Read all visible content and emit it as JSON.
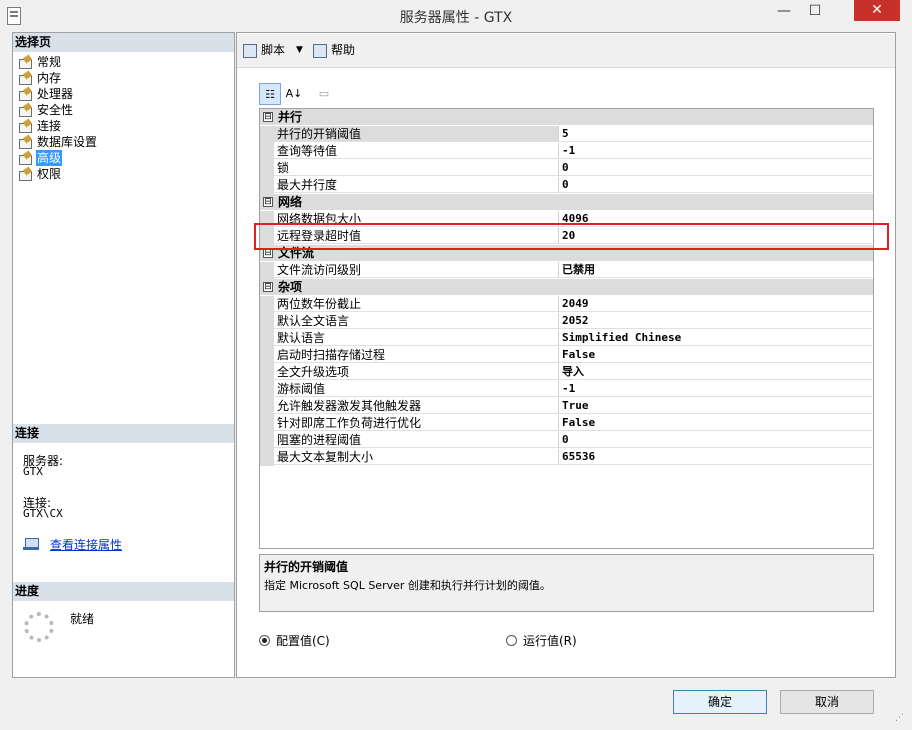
{
  "window": {
    "title": "服务器属性 - GTX",
    "minimize_label": "—",
    "maximize_label": "☐",
    "close_label": "✕"
  },
  "left": {
    "select_page_header": "选择页",
    "pages": [
      {
        "label": "常规"
      },
      {
        "label": "内存"
      },
      {
        "label": "处理器"
      },
      {
        "label": "安全性"
      },
      {
        "label": "连接"
      },
      {
        "label": "数据库设置"
      },
      {
        "label": "高级",
        "selected": true
      },
      {
        "label": "权限"
      }
    ],
    "connection_header": "连接",
    "server_label": "服务器:",
    "server_value": "GTX",
    "connection_label": "连接:",
    "connection_value": "GTX\\CX",
    "view_props_link": "查看连接属性",
    "progress_header": "进度",
    "progress_status": "就绪"
  },
  "toolbar": {
    "script_label": "脚本",
    "help_label": "帮助",
    "dropdown_glyph": "▼"
  },
  "grid_toolbar": {
    "categorized_glyph": "☷",
    "alpha_glyph": "A↓",
    "pages_glyph": "▭"
  },
  "grid": {
    "categories": [
      {
        "name": "并行",
        "toggle": "⊟",
        "rows": [
          {
            "name": "并行的开销阈值",
            "value": "5"
          },
          {
            "name": "查询等待值",
            "value": "-1"
          },
          {
            "name": "锁",
            "value": "0"
          },
          {
            "name": "最大并行度",
            "value": "0"
          }
        ]
      },
      {
        "name": "网络",
        "toggle": "⊟",
        "rows": [
          {
            "name": "网络数据包大小",
            "value": "4096"
          },
          {
            "name": "远程登录超时值",
            "value": "20"
          }
        ]
      },
      {
        "name": "文件流",
        "toggle": "⊟",
        "rows": [
          {
            "name": "文件流访问级别",
            "value": "已禁用"
          }
        ]
      },
      {
        "name": "杂项",
        "toggle": "⊟",
        "rows": [
          {
            "name": "两位数年份截止",
            "value": "2049"
          },
          {
            "name": "默认全文语言",
            "value": "2052"
          },
          {
            "name": "默认语言",
            "value": "Simplified Chinese"
          },
          {
            "name": "启动时扫描存储过程",
            "value": "False"
          },
          {
            "name": "全文升级选项",
            "value": "导入"
          },
          {
            "name": "游标阈值",
            "value": "-1"
          },
          {
            "name": "允许触发器激发其他触发器",
            "value": "True"
          },
          {
            "name": "针对即席工作负荷进行优化",
            "value": "False"
          },
          {
            "name": "阻塞的进程阈值",
            "value": "0"
          },
          {
            "name": "最大文本复制大小",
            "value": "65536"
          }
        ]
      }
    ]
  },
  "description": {
    "title": "并行的开销阈值",
    "text": "指定 Microsoft SQL Server 创建和执行并行计划的阈值。"
  },
  "radios": {
    "configured_label": "配置值(C)",
    "running_label": "运行值(R)",
    "selected": "configured"
  },
  "buttons": {
    "ok_label": "确定",
    "cancel_label": "取消"
  },
  "colors": {
    "highlight_border": "#e0201c",
    "selection": "#3399ff",
    "close_button": "#c7312a"
  }
}
